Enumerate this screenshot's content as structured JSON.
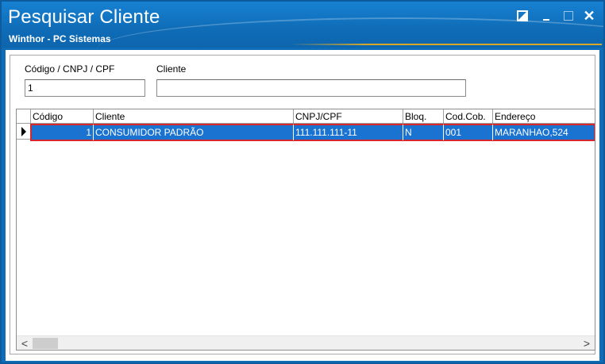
{
  "window": {
    "title": "Pesquisar Cliente",
    "subtitle": "Winthor - PC Sistemas",
    "controls": {
      "restore_icon": "restore-icon",
      "minimize_icon": "minimize-icon",
      "maximize_icon": "maximize-icon",
      "close_icon": "close-icon",
      "close_glyph": "✕"
    },
    "colors": {
      "titlebar": "#0f6db8",
      "selection": "#1a73d1",
      "highlight_border": "#d9262b",
      "accent_line": "#d8a928"
    }
  },
  "search": {
    "code_label": "Código / CNPJ / CPF",
    "code_value": "1",
    "client_label": "Cliente",
    "client_value": ""
  },
  "grid": {
    "columns": [
      "Código",
      "Cliente",
      "CNPJ/CPF",
      "Bloq.",
      "Cod.Cob.",
      "Endereço"
    ],
    "rows": [
      {
        "selected": true,
        "codigo": "1",
        "cliente": "CONSUMIDOR PADRÃO",
        "cnpj_cpf": "111.111.111-11",
        "bloq": "N",
        "cod_cob": "001",
        "endereco": "MARANHAO,524"
      }
    ],
    "row_indicator_icon": "row-pointer-icon",
    "scroll_left_glyph": "<",
    "scroll_right_glyph": ">"
  }
}
